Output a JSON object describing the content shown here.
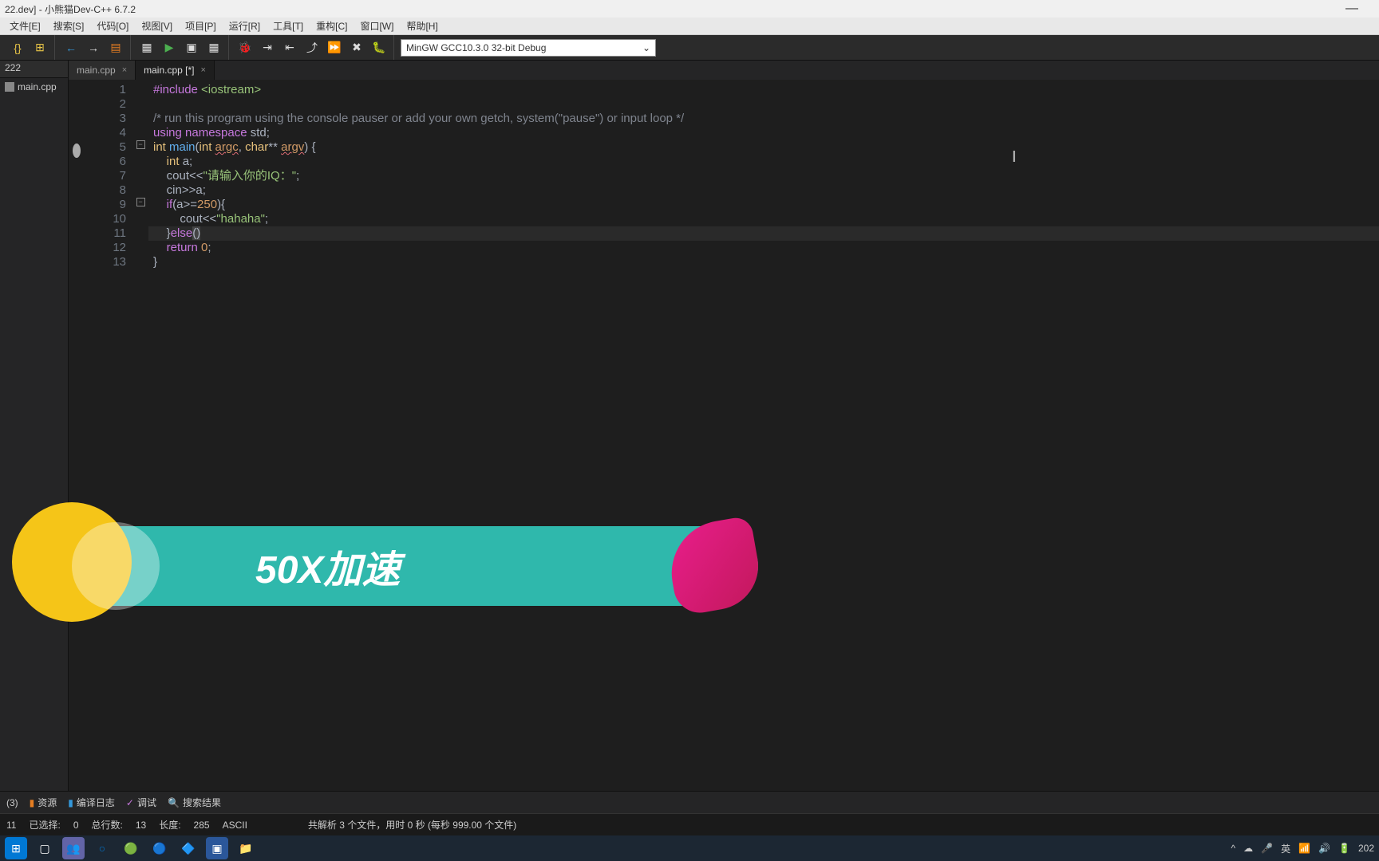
{
  "title": "22.dev] - 小熊猫Dev-C++ 6.7.2",
  "minimize": "—",
  "menus": [
    "文件[E]",
    "搜索[S]",
    "代码[O]",
    "视图[V]",
    "项目[P]",
    "运行[R]",
    "工具[T]",
    "重构[C]",
    "窗口[W]",
    "帮助[H]"
  ],
  "compiler": "MinGW GCC10.3.0 32-bit Debug",
  "sidebar": {
    "tab": "222",
    "file": "main.cpp"
  },
  "tabs": [
    {
      "label": "main.cpp",
      "close": "×",
      "active": false
    },
    {
      "label": "main.cpp [*]",
      "close": "×",
      "active": true
    }
  ],
  "code": {
    "l1": {
      "a": "#include ",
      "b": "<iostream>"
    },
    "l2": "",
    "l3": "/* run this program using the console pauser or add your own getch, system(\"pause\") or input loop */",
    "l4": {
      "a": "using ",
      "b": "namespace ",
      "c": "std;"
    },
    "l5": {
      "a": "int ",
      "b": "main",
      "c": "(",
      "d": "int ",
      "e": "argc",
      "f": ", ",
      "g": "char",
      "h": "** ",
      "i": "argv",
      "j": ") {"
    },
    "l6": {
      "a": "    ",
      "b": "int ",
      "c": "a;"
    },
    "l7": {
      "a": "    cout<<",
      "b": "\"请输入你的IQ：\"",
      "c": ";"
    },
    "l8": {
      "a": "    cin>>a;"
    },
    "l9": {
      "a": "    ",
      "b": "if",
      "c": "(a>=",
      "d": "250",
      "e": "){"
    },
    "l10": {
      "a": "        cout<<",
      "b": "\"hahaha\"",
      "c": ";"
    },
    "l11": {
      "a": "    }",
      "b": "else",
      "c": "()"
    },
    "l12": {
      "a": "    ",
      "b": "return ",
      "c": "0",
      "d": ";"
    },
    "l13": "}"
  },
  "bottom": {
    "issues": "(3)",
    "res": "资源",
    "log": "编译日志",
    "dbg": "调试",
    "sr": "搜索结果"
  },
  "status": {
    "line": "11",
    "sel": "已选择:",
    "selv": "0",
    "rows": "总行数:",
    "rowsv": "13",
    "len": "长度:",
    "lenv": "285",
    "enc": "ASCII",
    "parse": "共解析 3 个文件，用时 0 秒 (每秒 999.00 个文件)"
  },
  "overlay": "50X加速",
  "tray": {
    "ime": "英",
    "time": "202"
  }
}
